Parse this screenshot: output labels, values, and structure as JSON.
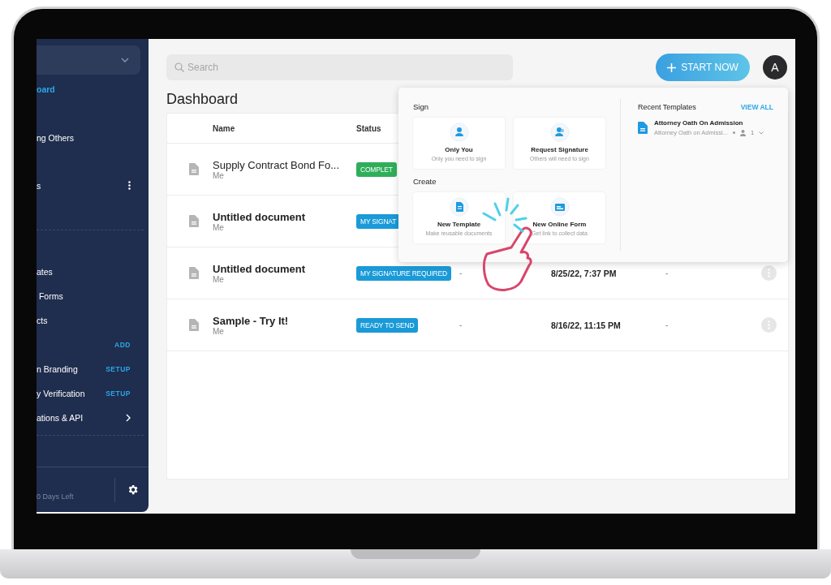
{
  "sidebar": {
    "sections": [
      {
        "items": [
          {
            "label": "oard",
            "selected": true,
            "kind": "plain"
          },
          {
            "label": "ng Others",
            "selected": false,
            "kind": "plain"
          },
          {
            "label": "s",
            "selected": false,
            "kind": "menu"
          }
        ]
      },
      {
        "items": [
          {
            "label": "ates",
            "selected": false,
            "kind": "plain"
          },
          {
            "label": " Forms",
            "selected": false,
            "kind": "plain"
          },
          {
            "label": "cts",
            "selected": false,
            "kind": "plain"
          },
          {
            "action": "ADD",
            "selected": false,
            "kind": "action"
          },
          {
            "label": "n Branding",
            "action": "SETUP",
            "selected": false,
            "kind": "action"
          },
          {
            "label": "y Verification",
            "action": "SETUP",
            "selected": false,
            "kind": "action"
          },
          {
            "label": "ations & API",
            "selected": false,
            "kind": "link"
          }
        ]
      }
    ],
    "trial": "0 Days Left"
  },
  "search": {
    "placeholder": "Search"
  },
  "start_button": "START NOW",
  "avatar": "A",
  "title": "Dashboard",
  "table": {
    "columns": [
      "Name",
      "Status"
    ],
    "rows": [
      {
        "name": "Supply Contract Bond Fo...",
        "owner": "Me",
        "status": {
          "label": "COMPLET",
          "color": "#2fae5a"
        }
      },
      {
        "name": "Untitled document",
        "owner": "Me",
        "status": {
          "label": "MY SIGNAT",
          "color": "#1a9ad8"
        }
      },
      {
        "name": "Untitled document",
        "owner": "Me",
        "status": {
          "label": "MY SIGNATURE REQUIRED",
          "color": "#1a9ad8"
        },
        "column_3": "-",
        "date": "8/25/22, 7:37 PM",
        "column_5": "-"
      },
      {
        "name": "Sample - Try It!",
        "owner": "Me",
        "status": {
          "label": "READY TO SEND",
          "color": "#1a9ad8"
        },
        "column_3": "-",
        "date": "8/16/22, 11:15 PM",
        "column_5": "-"
      }
    ]
  },
  "popover": {
    "groups": [
      {
        "title": "Sign",
        "options": [
          {
            "kind": "self",
            "title": "Only You",
            "subtitle": "Only you need to sign"
          },
          {
            "kind": "request",
            "title": "Request Signature",
            "subtitle": "Others will need to sign"
          }
        ]
      },
      {
        "title": "Create",
        "options": [
          {
            "kind": "template",
            "title": "New Template",
            "subtitle": "Make reusable documents"
          },
          {
            "kind": "form",
            "title": "New Online Form",
            "subtitle": "Get link to collect data"
          }
        ]
      }
    ],
    "recent": {
      "title": "Recent Templates",
      "view_all": "VIEW ALL",
      "templates": [
        {
          "name": "Attorney Oath On Admission",
          "subtitle": "Attorney Oath on Admissi...",
          "signers": "1"
        }
      ]
    }
  }
}
